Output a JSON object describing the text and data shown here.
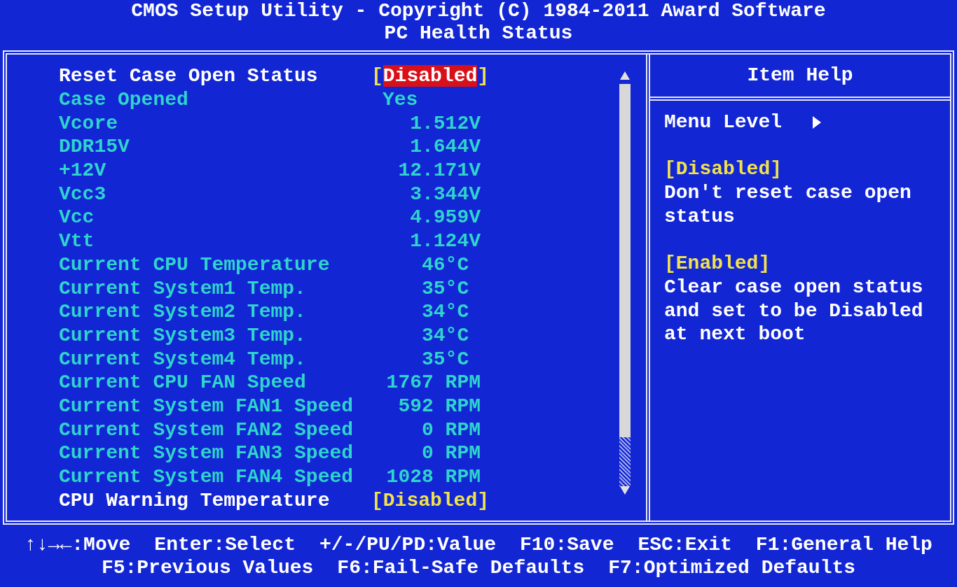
{
  "header": {
    "title": "CMOS Setup Utility - Copyright (C) 1984-2011 Award Software",
    "subtitle": "PC Health Status"
  },
  "items": [
    {
      "label": "Reset Case Open Status",
      "value": "[Disabled]",
      "kind": "option",
      "selected": true
    },
    {
      "label": "Case Opened",
      "value": "Yes",
      "kind": "status"
    },
    {
      "label": "Vcore",
      "value": "1.512V",
      "kind": "reading"
    },
    {
      "label": "DDR15V",
      "value": "1.644V",
      "kind": "reading"
    },
    {
      "label": "+12V",
      "value": "12.171V",
      "kind": "reading"
    },
    {
      "label": "Vcc3",
      "value": "3.344V",
      "kind": "reading"
    },
    {
      "label": "Vcc",
      "value": "4.959V",
      "kind": "reading"
    },
    {
      "label": "Vtt",
      "value": "1.124V",
      "kind": "reading"
    },
    {
      "label": "Current CPU Temperature",
      "value": "46°C ",
      "kind": "reading"
    },
    {
      "label": "Current System1 Temp.",
      "value": "35°C ",
      "kind": "reading"
    },
    {
      "label": "Current System2 Temp.",
      "value": "34°C ",
      "kind": "reading"
    },
    {
      "label": "Current System3 Temp.",
      "value": "34°C ",
      "kind": "reading"
    },
    {
      "label": "Current System4 Temp.",
      "value": "35°C ",
      "kind": "reading"
    },
    {
      "label": "Current CPU FAN Speed",
      "value": "1767 RPM",
      "kind": "reading"
    },
    {
      "label": "Current System FAN1 Speed",
      "value": "592 RPM",
      "kind": "reading"
    },
    {
      "label": "Current System FAN2 Speed",
      "value": "0 RPM",
      "kind": "reading"
    },
    {
      "label": "Current System FAN3 Speed",
      "value": "0 RPM",
      "kind": "reading"
    },
    {
      "label": "Current System FAN4 Speed",
      "value": "1028 RPM",
      "kind": "reading"
    },
    {
      "label": "CPU Warning Temperature",
      "value": "[Disabled]",
      "kind": "option",
      "selected": false
    }
  ],
  "help": {
    "title": "Item Help",
    "menu_level": "Menu Level",
    "entries": [
      {
        "option": "[Disabled]",
        "text": "Don't reset case open status"
      },
      {
        "option": "[Enabled]",
        "text": "Clear case open status and set to be Disabled at next boot"
      }
    ]
  },
  "footer": [
    [
      "↑↓→←:Move",
      "Enter:Select",
      "+/-/PU/PD:Value",
      "F10:Save",
      "ESC:Exit",
      "F1:General Help"
    ],
    [
      "F5:Previous Values",
      "F6:Fail-Safe Defaults",
      "F7:Optimized Defaults"
    ]
  ]
}
